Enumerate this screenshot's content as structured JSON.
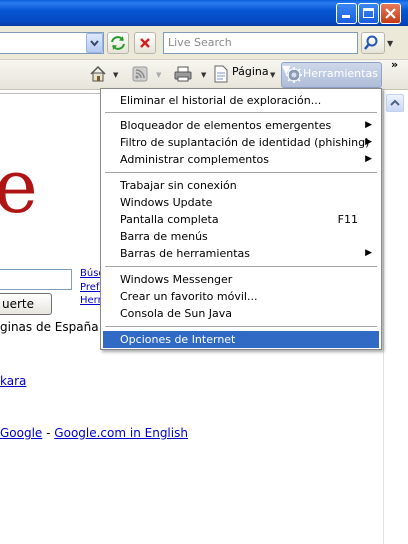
{
  "toolbar": {
    "search_placeholder": "Live Search",
    "pagina_label": "Página",
    "herramientas_label": "Herramientas",
    "more_chevrons": "»"
  },
  "menu": {
    "items": [
      {
        "label": "Eliminar el historial de exploración...",
        "submenu": false,
        "accel": ""
      },
      {
        "label": "Bloqueador de elementos emergentes",
        "submenu": true,
        "accel": ""
      },
      {
        "label": "Filtro de suplantación de identidad (phishing)",
        "submenu": true,
        "accel": ""
      },
      {
        "label": "Administrar complementos",
        "submenu": true,
        "accel": ""
      },
      {
        "label": "Trabajar sin conexión",
        "submenu": false,
        "accel": ""
      },
      {
        "label": "Windows Update",
        "submenu": false,
        "accel": ""
      },
      {
        "label": "Pantalla completa",
        "submenu": false,
        "accel": "F11"
      },
      {
        "label": "Barra de menús",
        "submenu": false,
        "accel": ""
      },
      {
        "label": "Barras de herramientas",
        "submenu": true,
        "accel": ""
      },
      {
        "label": "Windows Messenger",
        "submenu": false,
        "accel": ""
      },
      {
        "label": "Crear un favorito móvil...",
        "submenu": false,
        "accel": ""
      },
      {
        "label": "Consola de Sun Java",
        "submenu": false,
        "accel": ""
      },
      {
        "label": "Opciones de Internet",
        "submenu": false,
        "accel": "",
        "selected": true
      }
    ],
    "arrow_glyph": "▶"
  },
  "page": {
    "logo_fragment": "e",
    "side_links": [
      "Búsq",
      "Prefe",
      "Herra"
    ],
    "lucky_button": "uerte",
    "espana_text": "ginas de España",
    "kara_link": "kara",
    "footer_link1": "Google",
    "footer_sep": " - ",
    "footer_link2": "Google.com in English"
  },
  "colors": {
    "title_blue": "#0756d4",
    "menu_highlight": "#316ac5",
    "logo_red": "#b01515",
    "link_blue": "#0000cc"
  }
}
